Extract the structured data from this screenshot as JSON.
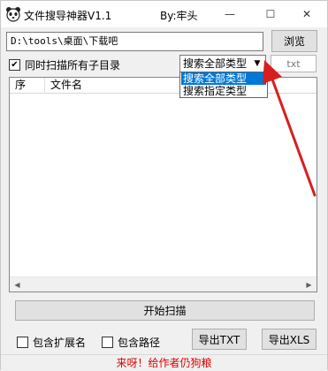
{
  "window": {
    "title": "文件搜导神器V1.1",
    "author": "By:牢头",
    "controls": {
      "minimize": "—",
      "maximize": "☐",
      "close": "✕"
    }
  },
  "path_field": {
    "value": "D:\\tools\\桌面\\下载吧"
  },
  "browse_button": {
    "label": "浏览"
  },
  "subdir_option": {
    "label": "同时扫描所有子目录",
    "checked": true
  },
  "type_select": {
    "selected": "搜索全部类型",
    "options": [
      "搜索全部类型",
      "搜索指定类型"
    ]
  },
  "extension_field": {
    "placeholder": "txt"
  },
  "file_list": {
    "columns": [
      "序",
      "文件名",
      ""
    ],
    "rows": []
  },
  "scan_button": {
    "label": "开始扫描"
  },
  "options": {
    "include_extension": {
      "label": "包含扩展名",
      "checked": false
    },
    "include_path": {
      "label": "包含路径",
      "checked": false
    }
  },
  "export": {
    "txt_label": "导出TXT",
    "xls_label": "导出XLS"
  },
  "status": {
    "text": "来呀！给作者仍狗粮"
  },
  "colors": {
    "annotation_arrow": "#d81e1e",
    "selection": "#0078d7",
    "status_text": "#e00000"
  },
  "icons": {
    "app": "bear-face-icon",
    "arrow": "red-annotation-arrow"
  }
}
